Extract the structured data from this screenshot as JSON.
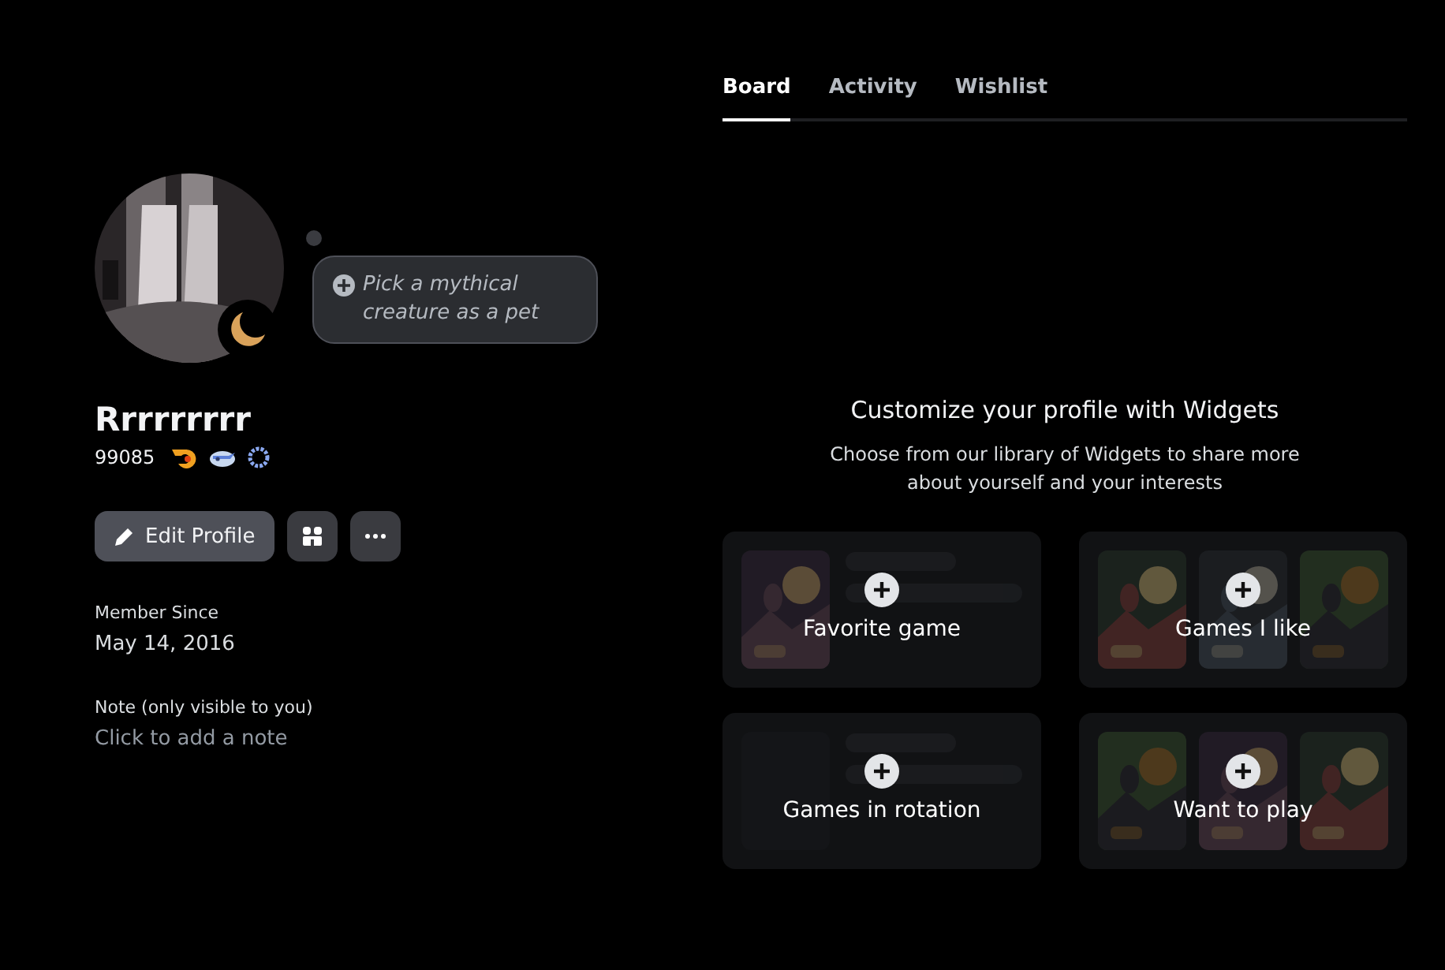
{
  "profile": {
    "status_bubble": "Pick a mythical creature as a pet",
    "display_name": "Rrrrrrrrr",
    "tag": "99085",
    "badges": [
      {
        "kind": "flame"
      },
      {
        "kind": "bird"
      },
      {
        "kind": "wreath"
      }
    ],
    "actions": {
      "edit": "Edit Profile"
    }
  },
  "member_since": {
    "label": "Member Since",
    "value": "May 14, 2016"
  },
  "note": {
    "label": "Note (only visible to you)",
    "placeholder": "Click to add a note"
  },
  "tabs": [
    {
      "label": "Board",
      "selected": true
    },
    {
      "label": "Activity",
      "selected": false
    },
    {
      "label": "Wishlist",
      "selected": false
    }
  ],
  "board": {
    "title": "Customize your profile with Widgets",
    "subtitle": "Choose from our library of Widgets to share more about yourself and your interests",
    "widgets": [
      {
        "kind": "cover",
        "label": "Favorite game"
      },
      {
        "kind": "triple",
        "label": "Games I like"
      },
      {
        "kind": "empty",
        "label": "Games in rotation"
      },
      {
        "kind": "triple",
        "label": "Want to play"
      }
    ]
  }
}
